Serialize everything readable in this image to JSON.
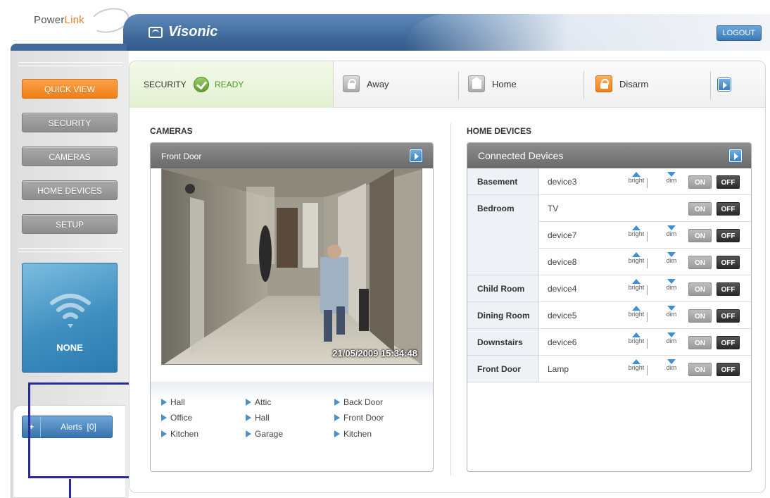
{
  "logo": {
    "text_a": "Power",
    "text_b": "Link"
  },
  "header": {
    "brand": "Visonic",
    "logout": "LOGOUT"
  },
  "nav": {
    "quick_view": "QUICK VIEW",
    "security": "SECURITY",
    "cameras": "CAMERAS",
    "home_devices": "HOME DEVICES",
    "setup": "SETUP"
  },
  "network": {
    "label": "NONE",
    "icon": "wifi-icon"
  },
  "alerts": {
    "plus": "+",
    "label": "Alerts",
    "count": "[0]"
  },
  "security_bar": {
    "label": "SECURITY",
    "status": "READY",
    "modes": [
      "Away",
      "Home",
      "Disarm"
    ]
  },
  "cameras": {
    "heading": "CAMERAS",
    "current": "Front Door",
    "timestamp": "21/05/2009 15:34:48",
    "links": [
      [
        "Hall",
        "Attic",
        "Back Door"
      ],
      [
        "Office",
        "Hall",
        "Front Door"
      ],
      [
        "Kitchen",
        "Garage",
        "Kitchen"
      ]
    ]
  },
  "devices": {
    "heading": "HOME DEVICES",
    "box_title": "Connected Devices",
    "bright": "bright",
    "dim": "dim",
    "on": "ON",
    "off": "OFF",
    "rooms": [
      "Basement",
      "Bedroom",
      "Child Room",
      "Dining Room",
      "Downstairs",
      "Front Door"
    ],
    "names": [
      "device3",
      "TV",
      "device7",
      "device8",
      "device4",
      "device5",
      "device6",
      "Lamp"
    ]
  },
  "colors": {
    "accent": "#f07f16",
    "brand_blue": "#3f6a9a",
    "ready_green": "#4a9a22"
  }
}
